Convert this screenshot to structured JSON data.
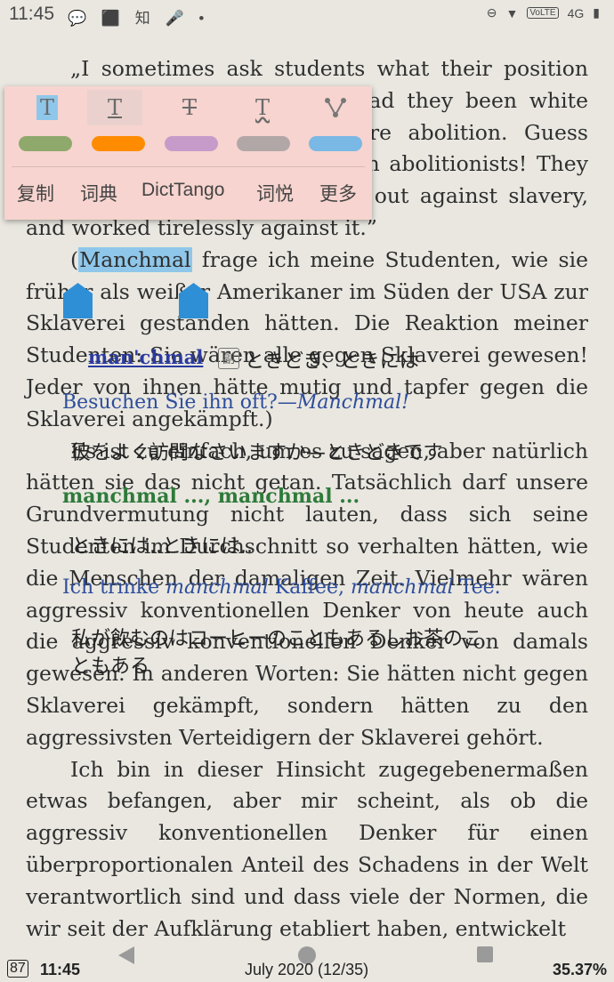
{
  "status_bar": {
    "time": "11:45",
    "left_icons": "💬 ⬛ 知 🎤 •",
    "network_badge": "VoLTE",
    "network": "4G"
  },
  "book": {
    "p1": "„I sometimes ask students what their position on slavery would have been had they been white and living in the South before abolition. Guess what? They all would have been abolitionists! They all would have bravely spoken out against slavery, and worked tirelessly against it.”",
    "p2_before": "(",
    "p2_selected": "Manchmal",
    "p2_after": " frage ich meine Studenten, wie sie früher als weißer Amerikaner im Süden der USA zur Sklaverei gestanden hätten. Die Reaktion meiner Studenten: Sie wären alle gegen Sklaverei gewesen! Jeder von ihnen hätte mutig und tapfer gegen die Sklaverei angekämpft.)",
    "p3": "Es ist zu einfach, um es zu sagen, aber natürlich hätten sie das nicht getan. Tatsächlich darf unsere Grundvermutung nicht lauten, dass sich seine Studenten im Durchschnitt so verhalten hätten, wie die Menschen der damaligen Zeit. Vielmehr wären aggressiv konventionellen Denker von heute auch die aggressiv konventionellen Denker von damals gewesen. In anderen Worten: Sie hätten nicht gegen Sklaverei gekämpft, sondern hätten zu den aggressivsten Verteidigern der Sklaverei gehört.",
    "p4": "Ich bin in dieser Hinsicht zugegebenermaßen etwas befangen, aber mir scheint, als ob die aggressiv konventionellen Denker für einen überproportionalen Anteil des Schadens in der Welt verantwortlich sind und dass viele der Normen, die wir seit der Aufklärung etabliert haben, entwickelt"
  },
  "popup": {
    "style_buttons": [
      "T",
      "T",
      "T",
      "T",
      "⑂"
    ],
    "swatch_colors": [
      "#8fa86c",
      "#ff8c00",
      "#c79bc9",
      "#b2a7a7",
      "#7ab8e6"
    ],
    "menu": [
      "复制",
      "词典",
      "DictTango",
      "词悦",
      "更多"
    ]
  },
  "dictionary": {
    "headword": "man'chmal",
    "pos_icon": "副",
    "reading": "ときどき、ときには",
    "example1_de": "Besuchen Sie ihn oft?—Manchmal!",
    "example1_jp": "彼をよく訪問なさいますか—ときどきです",
    "example2_de": "manchmal ..., manchmal ...",
    "example2_jp": "ときには..ときには..",
    "example3_de": "Ich trinke manchmal Kaffee, manchmal Tee.",
    "example3_jp_line1": "私が飲むのはコーヒーのこともあるしお茶のこ",
    "example3_jp_line2": "ともある"
  },
  "footer": {
    "battery": "87",
    "time": "11:45",
    "chapter": "July 2020 (12/35)",
    "percent": "35.37%"
  }
}
